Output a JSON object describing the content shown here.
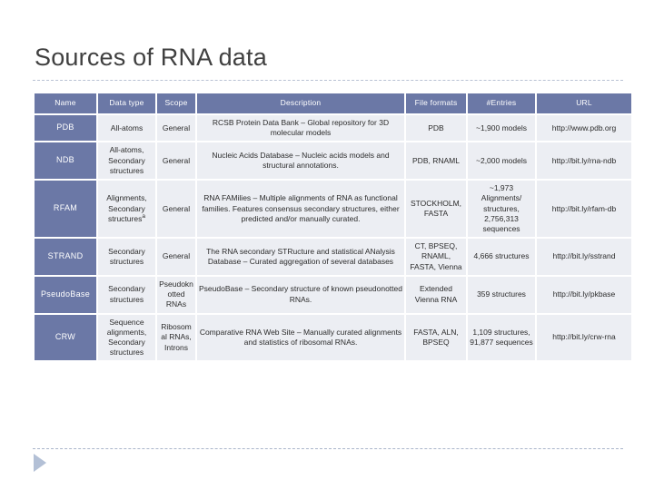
{
  "slide": {
    "title": "Sources of RNA data",
    "theme": {
      "header_blue": "#6b78a6",
      "cell_gray": "#eceef3",
      "title_gray": "#404040",
      "rule_dashed": "#b9c2d4",
      "arrow_blue": "#b3c0d6"
    },
    "footer": {
      "arrow_icon": "play-triangle-icon"
    }
  },
  "table": {
    "headers": [
      "Name",
      "Data type",
      "Scope",
      "Description",
      "File formats",
      "#Entries",
      "URL"
    ],
    "rows": [
      {
        "name": "PDB",
        "data_type": "All-atoms",
        "scope": "General",
        "description": "RCSB Protein Data Bank – Global repository for 3D molecular models",
        "file_formats": "PDB",
        "entries": "~1,900 models",
        "url": "http://www.pdb.org"
      },
      {
        "name": "NDB",
        "data_type": "All-atoms, Secondary structures",
        "scope": "General",
        "description": "Nucleic Acids Database – Nucleic acids models and structural annotations.",
        "file_formats": "PDB, RNAML",
        "entries": "~2,000 models",
        "url": "http://bit.ly/rna-ndb"
      },
      {
        "name": "RFAM",
        "data_type": "Alignments, Secondary structures",
        "data_type_note": "a",
        "scope": "General",
        "description": "RNA FAMilies – Multiple alignments of RNA as functional families. Features consensus secondary structures, either predicted and/or manually curated.",
        "file_formats": "STOCKHOLM, FASTA",
        "entries": "~1,973 Alignments/ structures, 2,756,313 sequences",
        "url": "http://bit.ly/rfam-db"
      },
      {
        "name": "STRAND",
        "data_type": "Secondary structures",
        "scope": "General",
        "description": "The RNA secondary STRucture and statistical ANalysis Database – Curated aggregation of several databases",
        "file_formats": "CT, BPSEQ, RNAML, FASTA, Vienna",
        "entries": "4,666 structures",
        "url": "http://bit.ly/sstrand"
      },
      {
        "name": "PseudoBase",
        "data_type": "Secondary structures",
        "scope": "Pseudoknotted RNAs",
        "description": "PseudoBase – Secondary structure of known pseudonotted RNAs.",
        "file_formats": "Extended Vienna RNA",
        "entries": "359 structures",
        "url": "http://bit.ly/pkbase"
      },
      {
        "name": "CRW",
        "data_type": "Sequence alignments, Secondary structures",
        "scope": "Ribosomal RNAs, Introns",
        "description": "Comparative RNA Web Site – Manually curated alignments and statistics of ribosomal RNAs.",
        "file_formats": "FASTA, ALN, BPSEQ",
        "entries": "1,109 structures, 91,877 sequences",
        "url": "http://bit.ly/crw-rna"
      }
    ]
  }
}
